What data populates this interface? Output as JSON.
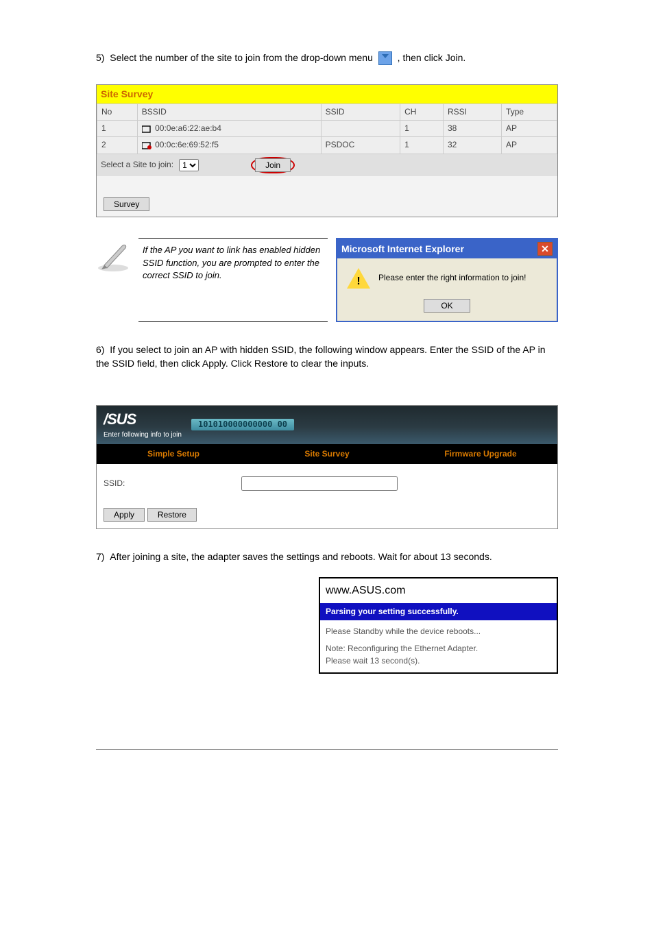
{
  "step5": {
    "text_before": "5)  Select the number of the site to join from the drop-down menu ",
    "text_after": ", then click Join."
  },
  "survey": {
    "title": "Site Survey",
    "headers": {
      "no": "No",
      "bssid": "BSSID",
      "ssid": "SSID",
      "ch": "CH",
      "rssi": "RSSI",
      "type": "Type"
    },
    "rows": [
      {
        "no": "1",
        "bssid": "00:0e:a6:22:ae:b4",
        "ssid": "",
        "ch": "1",
        "rssi": "38",
        "type": "AP"
      },
      {
        "no": "2",
        "bssid": "00:0c:6e:69:52:f5",
        "ssid": "PSDOC",
        "ch": "1",
        "rssi": "32",
        "type": "AP"
      }
    ],
    "select_label": "Select a Site to join:",
    "selected": "1",
    "join_btn": "Join",
    "survey_btn": "Survey"
  },
  "note": "If the AP you want to link has enabled hidden SSID function, you are prompted to enter the correct SSID to join.",
  "dialog": {
    "title": "Microsoft Internet Explorer",
    "message": "Please enter the right information to join!",
    "ok": "OK"
  },
  "step6": "6)  If you select to join an AP with hidden SSID, the following window appears. Enter the SSID of the AP in the SSID field, then click Apply. Click Restore to clear the inputs.",
  "hidden_panel": {
    "sub": "Enter following info to join",
    "mac": "101010000000000 00",
    "nav": {
      "simple": "Simple Setup",
      "site": "Site Survey",
      "fw": "Firmware Upgrade"
    },
    "ssid_label": "SSID:",
    "apply": "Apply",
    "restore": "Restore"
  },
  "step7": "7)  After joining a site, the adapter saves the settings and reboots. Wait for about 13 seconds.",
  "reboot": {
    "url": "www.ASUS.com",
    "banner": "Parsing your setting successfully.",
    "line1": "Please Standby while the device reboots...",
    "line2": "Note: Reconfiguring the Ethernet Adapter.",
    "line3": "Please wait 13 second(s)."
  }
}
